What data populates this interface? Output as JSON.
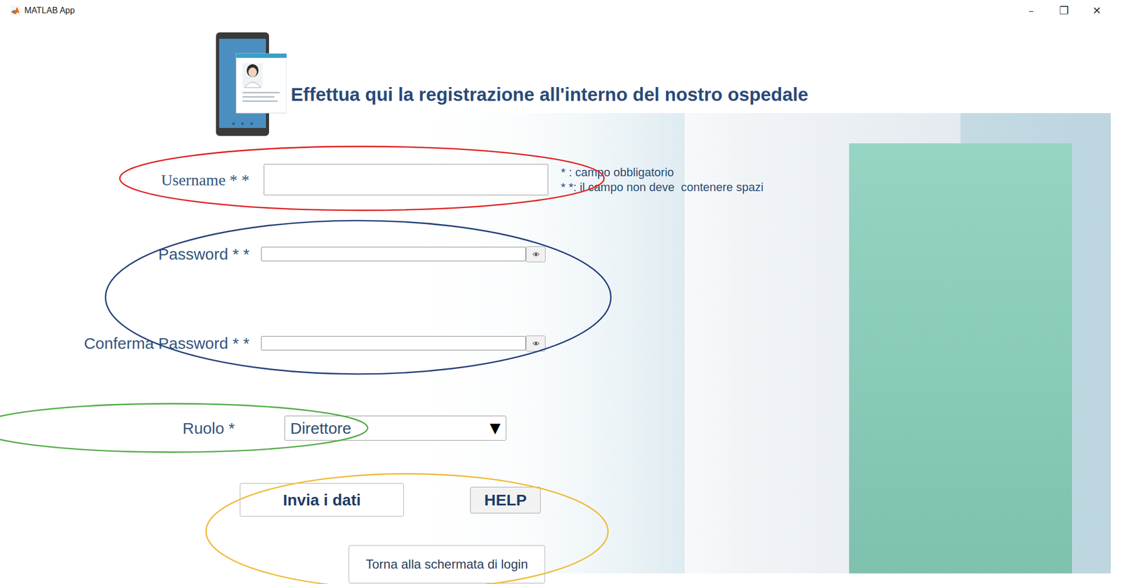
{
  "window": {
    "title": "MATLAB App",
    "controls": [
      "–",
      "❐",
      "✕"
    ]
  },
  "heading": "Effettua qui la registrazione all'interno del nostro ospedale",
  "form": {
    "username": {
      "label": "Username * *"
    },
    "notes": [
      "* : campo obbligatorio",
      "* *: il campo non deve  contenere spazi"
    ],
    "password": {
      "label": "Password * *"
    },
    "confirm_password": {
      "label": "Conferma Password * *"
    },
    "role": {
      "label": "Ruolo *",
      "value": "Direttore",
      "arrow": "▼"
    }
  },
  "buttons": {
    "submit": "Invia i dati",
    "help": "HELP",
    "back": "Torna alla schermata di login"
  },
  "annotations": [
    {
      "color": "#e02020"
    },
    {
      "color": "#24407a"
    },
    {
      "color": "#55ad4a"
    },
    {
      "color": "#f0bb3a"
    }
  ]
}
